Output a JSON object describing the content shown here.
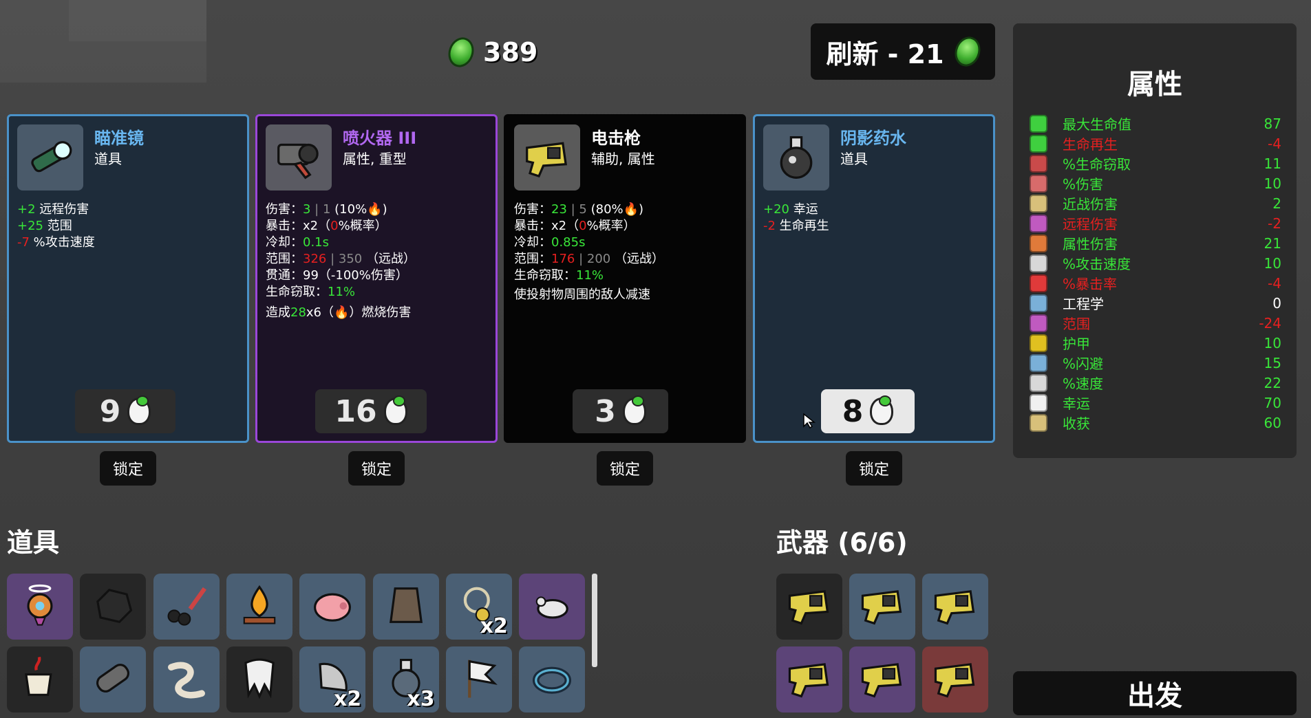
{
  "currency": {
    "amount": "389"
  },
  "reroll": {
    "label": "刷新 - 21"
  },
  "stats": {
    "title": "属性",
    "rows": [
      {
        "label": "最大生命值",
        "value": "87",
        "tone": "pos",
        "icon": "heart-icon",
        "color": "#3fd03f"
      },
      {
        "label": "生命再生",
        "value": "-4",
        "tone": "neg",
        "icon": "heart-plus-icon",
        "color": "#3fd03f"
      },
      {
        "label": "%生命窃取",
        "value": "11",
        "tone": "pos",
        "icon": "fang-icon",
        "color": "#c94a4a"
      },
      {
        "label": "%伤害",
        "value": "10",
        "tone": "pos",
        "icon": "fist-icon",
        "color": "#d86b6b"
      },
      {
        "label": "近战伤害",
        "value": "2",
        "tone": "pos",
        "icon": "sword-icon",
        "color": "#d8c07a"
      },
      {
        "label": "远程伤害",
        "value": "-2",
        "tone": "neg",
        "icon": "bow-icon",
        "color": "#c05ac0"
      },
      {
        "label": "属性伤害",
        "value": "21",
        "tone": "pos",
        "icon": "flame-icon",
        "color": "#e07a3a"
      },
      {
        "label": "%攻击速度",
        "value": "10",
        "tone": "pos",
        "icon": "hourglass-icon",
        "color": "#d8d8d8"
      },
      {
        "label": "%暴击率",
        "value": "-4",
        "tone": "neg",
        "icon": "crit-icon",
        "color": "#e03a3a"
      },
      {
        "label": "工程学",
        "value": "0",
        "tone": "neu",
        "icon": "wrench-icon",
        "color": "#7ab0d8"
      },
      {
        "label": "范围",
        "value": "-24",
        "tone": "neg",
        "icon": "range-icon",
        "color": "#c05ac0"
      },
      {
        "label": "护甲",
        "value": "10",
        "tone": "pos",
        "icon": "shield-icon",
        "color": "#e0c020"
      },
      {
        "label": "%闪避",
        "value": "15",
        "tone": "pos",
        "icon": "dodge-icon",
        "color": "#7ab0d8"
      },
      {
        "label": "%速度",
        "value": "22",
        "tone": "pos",
        "icon": "boot-icon",
        "color": "#d8d8d8"
      },
      {
        "label": "幸运",
        "value": "70",
        "tone": "pos",
        "icon": "dice-icon",
        "color": "#f0f0f0"
      },
      {
        "label": "收获",
        "value": "60",
        "tone": "pos",
        "icon": "wheat-icon",
        "color": "#d8c07a"
      }
    ]
  },
  "shop": {
    "lock_label": "锁定",
    "cards": [
      {
        "name": "瞄准镜",
        "type": "道具",
        "price": "9",
        "style": "blue",
        "icon": "scope-icon",
        "lines": [
          [
            {
              "t": "+2",
              "c": "pos"
            },
            {
              "t": " 远程伤害",
              "c": "neu"
            }
          ],
          [
            {
              "t": "+25",
              "c": "pos"
            },
            {
              "t": " 范围",
              "c": "neu"
            }
          ],
          [
            {
              "t": "-7",
              "c": "neg"
            },
            {
              "t": " %攻击速度",
              "c": "neu"
            }
          ]
        ]
      },
      {
        "name": "喷火器 III",
        "type": "属性, 重型",
        "price": "16",
        "style": "purple",
        "icon": "flamethrower-icon",
        "lines": [
          [
            {
              "t": "伤害：",
              "c": "neu"
            },
            {
              "t": "3",
              "c": "pos"
            },
            {
              "t": " | 1 ",
              "c": "gray"
            },
            {
              "t": "(10%🔥)",
              "c": "neu"
            }
          ],
          [
            {
              "t": "暴击：x2（",
              "c": "neu"
            },
            {
              "t": "0",
              "c": "neg"
            },
            {
              "t": "%概率）",
              "c": "neu"
            }
          ],
          [
            {
              "t": "冷却：",
              "c": "neu"
            },
            {
              "t": "0.1s",
              "c": "pos"
            }
          ],
          [
            {
              "t": "范围：",
              "c": "neu"
            },
            {
              "t": "326",
              "c": "neg"
            },
            {
              "t": " | 350 ",
              "c": "gray"
            },
            {
              "t": "（远战）",
              "c": "neu"
            }
          ],
          [
            {
              "t": "贯通：99（-100%伤害）",
              "c": "neu"
            }
          ],
          [
            {
              "t": "生命窃取：",
              "c": "neu"
            },
            {
              "t": "11%",
              "c": "pos"
            }
          ],
          [
            {
              "t": "造成",
              "c": "neu"
            },
            {
              "t": "28",
              "c": "pos"
            },
            {
              "t": "x6（🔥）燃烧伤害",
              "c": "neu"
            }
          ]
        ]
      },
      {
        "name": "电击枪",
        "type": "辅助, 属性",
        "price": "3",
        "style": "black",
        "icon": "taser-icon",
        "lines": [
          [
            {
              "t": "伤害：",
              "c": "neu"
            },
            {
              "t": "23",
              "c": "pos"
            },
            {
              "t": " | 5 ",
              "c": "gray"
            },
            {
              "t": "(80%🔥)",
              "c": "neu"
            }
          ],
          [
            {
              "t": "暴击：x2（",
              "c": "neu"
            },
            {
              "t": "0",
              "c": "neg"
            },
            {
              "t": "%概率）",
              "c": "neu"
            }
          ],
          [
            {
              "t": "冷却：",
              "c": "neu"
            },
            {
              "t": "0.85s",
              "c": "pos"
            }
          ],
          [
            {
              "t": "范围：",
              "c": "neu"
            },
            {
              "t": "176",
              "c": "neg"
            },
            {
              "t": " | 200 ",
              "c": "gray"
            },
            {
              "t": "（远战）",
              "c": "neu"
            }
          ],
          [
            {
              "t": "生命窃取：",
              "c": "neu"
            },
            {
              "t": "11%",
              "c": "pos"
            }
          ],
          [
            {
              "t": "使投射物周围的敌人减速",
              "c": "neu"
            }
          ]
        ]
      },
      {
        "name": "阴影药水",
        "type": "道具",
        "price": "8",
        "style": "blue",
        "icon": "potion-icon",
        "lines": [
          [
            {
              "t": "+20",
              "c": "pos"
            },
            {
              "t": " 幸运",
              "c": "neu"
            }
          ],
          [
            {
              "t": "-2",
              "c": "neg"
            },
            {
              "t": " 生命再生",
              "c": "neu"
            }
          ]
        ]
      }
    ]
  },
  "items": {
    "title": "道具",
    "slots": [
      {
        "icon": "halo-bulb-icon",
        "bg": "purple",
        "qty": ""
      },
      {
        "icon": "rock-icon",
        "bg": "black",
        "qty": ""
      },
      {
        "icon": "cherry-knife-icon",
        "bg": "blue",
        "qty": ""
      },
      {
        "icon": "campfire-icon",
        "bg": "blue",
        "qty": ""
      },
      {
        "icon": "piggy-bank-icon",
        "bg": "blue",
        "qty": ""
      },
      {
        "icon": "leather-vest-icon",
        "bg": "blue",
        "qty": ""
      },
      {
        "icon": "gold-necklace-icon",
        "bg": "blue",
        "qty": "x2"
      },
      {
        "icon": "rat-icon",
        "bg": "purple",
        "qty": ""
      },
      {
        "icon": "coffee-cup-icon",
        "bg": "black",
        "qty": ""
      },
      {
        "icon": "fossil-icon",
        "bg": "blue",
        "qty": ""
      },
      {
        "icon": "worm-icon",
        "bg": "blue",
        "qty": ""
      },
      {
        "icon": "tooth-icon",
        "bg": "black",
        "qty": ""
      },
      {
        "icon": "blade-icon",
        "bg": "blue",
        "qty": "x2"
      },
      {
        "icon": "flask-icon",
        "bg": "blue",
        "qty": "x3"
      },
      {
        "icon": "white-flag-icon",
        "bg": "blue",
        "qty": ""
      },
      {
        "icon": "ring-icon",
        "bg": "blue",
        "qty": ""
      }
    ]
  },
  "weapons": {
    "title": "武器 (6/6)",
    "slots": [
      {
        "icon": "taser-icon",
        "bg": "black"
      },
      {
        "icon": "taser-icon",
        "bg": "blue"
      },
      {
        "icon": "taser-icon",
        "bg": "blue"
      },
      {
        "icon": "taser-icon",
        "bg": "purple"
      },
      {
        "icon": "taser-icon",
        "bg": "purple"
      },
      {
        "icon": "taser-icon",
        "bg": "red"
      }
    ]
  },
  "start_button": {
    "label": "出发"
  }
}
